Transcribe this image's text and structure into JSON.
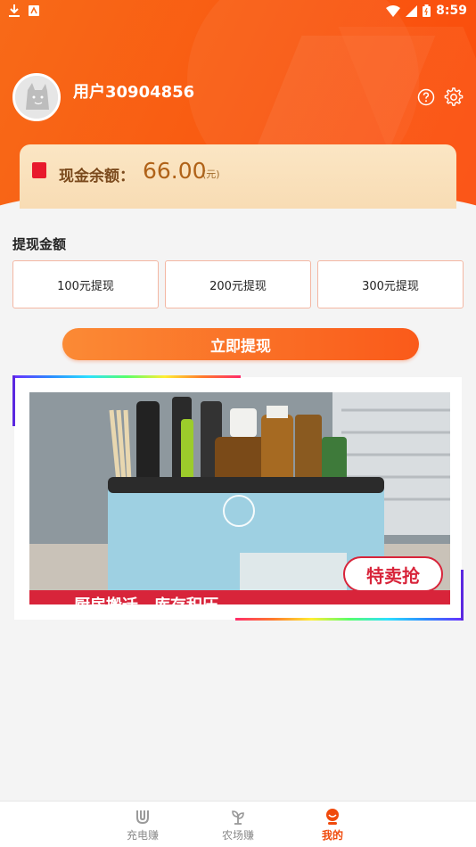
{
  "status_bar": {
    "time": "8:59",
    "icons": [
      "download-icon",
      "notification-icon",
      "wifi-icon",
      "signal-icon",
      "battery-icon"
    ]
  },
  "profile": {
    "username": "用户30904856",
    "icons": [
      "help-icon",
      "gear-icon"
    ]
  },
  "balance": {
    "label": "现金余额：",
    "value": "66.00",
    "unit": "(元)"
  },
  "withdraw": {
    "title": "提现金额",
    "options": [
      "100元提现",
      "200元提现",
      "300元提现"
    ],
    "button_label": "立即提现"
  },
  "ad": {
    "caption": "厨房搬迁，库存积压",
    "badge": "特卖抢"
  },
  "bottom_nav": {
    "items": [
      {
        "label": "充电赚",
        "icon": "magnet-icon"
      },
      {
        "label": "农场赚",
        "icon": "sprout-icon"
      },
      {
        "label": "我的",
        "icon": "user-icon"
      }
    ],
    "active_index": 2
  },
  "colors": {
    "brand_orange": "#fa5a1a",
    "balance_text": "#b06218",
    "nav_active": "#f04a0c"
  }
}
